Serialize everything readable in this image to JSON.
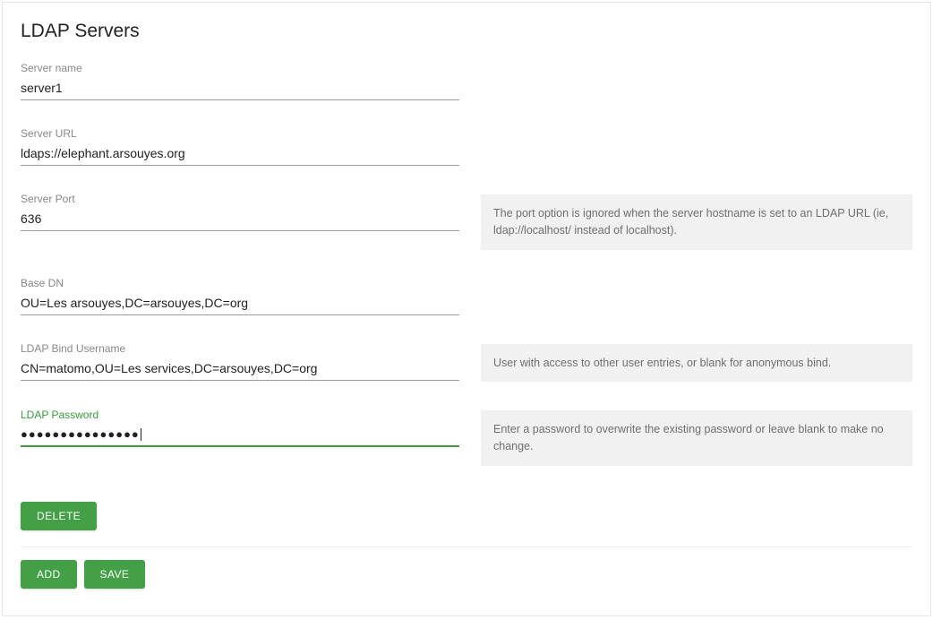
{
  "page": {
    "title": "LDAP Servers"
  },
  "fields": {
    "server_name": {
      "label": "Server name",
      "value": "server1"
    },
    "server_url": {
      "label": "Server URL",
      "value": "ldaps://elephant.arsouyes.org"
    },
    "server_port": {
      "label": "Server Port",
      "value": "636",
      "help": "The port option is ignored when the server hostname is set to an LDAP URL (ie, ldap://localhost/ instead of localhost)."
    },
    "base_dn": {
      "label": "Base DN",
      "value": "OU=Les arsouyes,DC=arsouyes,DC=org"
    },
    "bind_user": {
      "label": "LDAP Bind Username",
      "value": "CN=matomo,OU=Les services,DC=arsouyes,DC=org",
      "help": "User with access to other user entries, or blank for anonymous bind."
    },
    "password": {
      "label": "LDAP Password",
      "value": "●●●●●●●●●●●●●●●",
      "help": "Enter a password to overwrite the existing password or leave blank to make no change."
    }
  },
  "buttons": {
    "delete": "DELETE",
    "add": "ADD",
    "save": "SAVE"
  }
}
